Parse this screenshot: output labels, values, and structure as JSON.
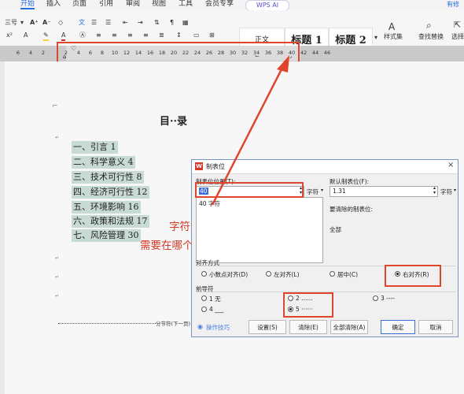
{
  "menubar": {
    "tabs": [
      "开始",
      "插入",
      "页面",
      "引用",
      "审阅",
      "视图",
      "工具",
      "会员专享"
    ],
    "wps_ai": "WPS AI",
    "right_label": "有修"
  },
  "ribbon": {
    "font_size": "三号",
    "style_body": "正文",
    "style_h1": "标题 1",
    "style_h2": "标题 2",
    "style_set": "样式集",
    "find_replace": "查找替换",
    "select": "选择"
  },
  "ruler": {
    "ticks": [
      "6",
      "4",
      "2",
      "2",
      "4",
      "6",
      "8",
      "10",
      "12",
      "14",
      "16",
      "18",
      "20",
      "22",
      "24",
      "26",
      "28",
      "30",
      "32",
      "34",
      "36",
      "38",
      "40",
      "42",
      "44",
      "46"
    ]
  },
  "document": {
    "toc_title": "目··录",
    "toc_items": [
      "一、引言 1",
      "二、科学意义 4",
      "三、技术可行性 8",
      "四、经济可行性 12",
      "五、环境影响 16",
      "六、政策和法规 17",
      "七、风险管理 30"
    ],
    "section_break": "分节符(下一页)",
    "annotation_line1": "字符数对应标尺上的数字，",
    "annotation_line2": "需要在哪个地方对其就填对应的数字"
  },
  "dialog": {
    "title": "制表位",
    "tab_position_label": "制表位位置(T):",
    "tab_position_value": "40",
    "tab_position_unit": "字符",
    "tab_list_item": "40 字符",
    "default_tab_label": "默认制表位(F):",
    "default_tab_value": "1.31",
    "default_tab_unit": "字符",
    "to_clear_label": "要清除的制表位:",
    "to_clear_value": "全部",
    "alignment_label": "对齐方式",
    "alignment_options": [
      "小数点对齐(D)",
      "左对齐(L)",
      "居中(C)",
      "右对齐(R)"
    ],
    "alignment_selected": "右对齐(R)",
    "leader_label": "前导符",
    "leader_options": [
      "1 无",
      "2 ......",
      "3 ----",
      "4 ___",
      "5 ······"
    ],
    "leader_selected": "5 ······",
    "tips_link": "操作技巧",
    "buttons": {
      "set": "设置(S)",
      "clear": "清除(E)",
      "clear_all": "全部清除(A)",
      "ok": "确定",
      "cancel": "取消"
    }
  },
  "colors": {
    "accent": "#2a6de0",
    "annotation_red": "#e0462c",
    "toc_highlight": "#c8dad4"
  }
}
